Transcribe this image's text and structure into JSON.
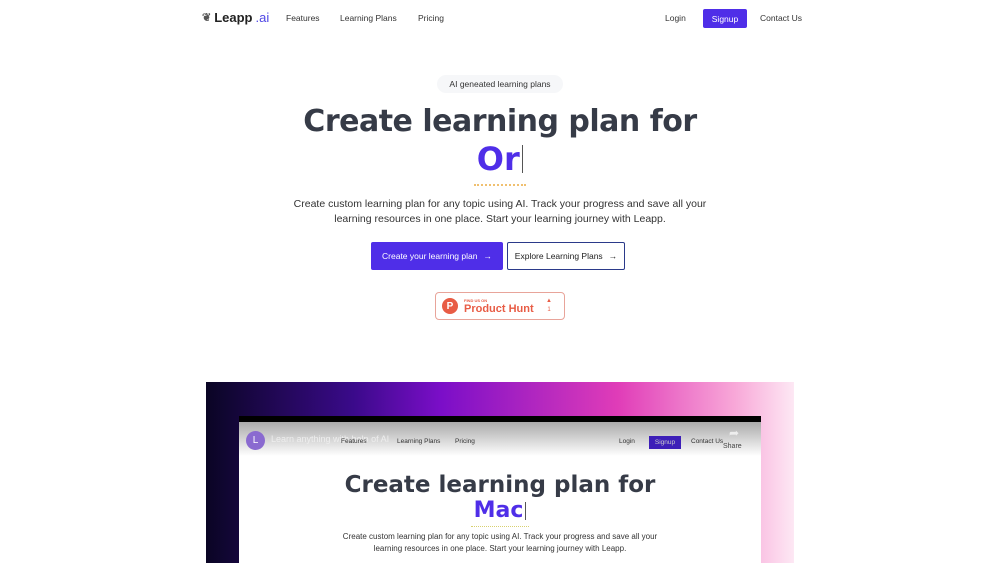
{
  "nav": {
    "logo_main": "Leapp",
    "logo_suffix": ".ai",
    "links": [
      "Features",
      "Learning Plans",
      "Pricing"
    ],
    "login": "Login",
    "signup": "Signup",
    "contact": "Contact Us"
  },
  "hero": {
    "badge": "AI geneated learning plans",
    "title": "Create learning plan for",
    "typed": "Or",
    "subtitle_line1": "Create custom learning plan for any topic using AI. Track your progress and save all your",
    "subtitle_line2": "learning resources in one place. Start your learning journey with Leapp.",
    "cta_primary": "Create your learning plan",
    "cta_secondary": "Explore Learning Plans",
    "arrow": "→"
  },
  "product_hunt": {
    "small": "FIND US ON",
    "name": "Product Hunt",
    "votes": "1",
    "letter": "P"
  },
  "video": {
    "avatar": "L",
    "title": "Learn anything with help of AI",
    "nav_links": [
      "Features",
      "Learning Plans",
      "Pricing"
    ],
    "login": "Login",
    "signup": "Signup",
    "contact": "Contact Us",
    "share": "Share",
    "heading": "Create learning plan for",
    "typed": "Mac",
    "sub1": "Create custom learning plan for any topic using AI. Track your progress and save all your",
    "sub2": "learning resources in one place. Start your learning journey with Leapp."
  },
  "colors": {
    "accent": "#4f2ee8",
    "product_hunt": "#e85c45"
  }
}
